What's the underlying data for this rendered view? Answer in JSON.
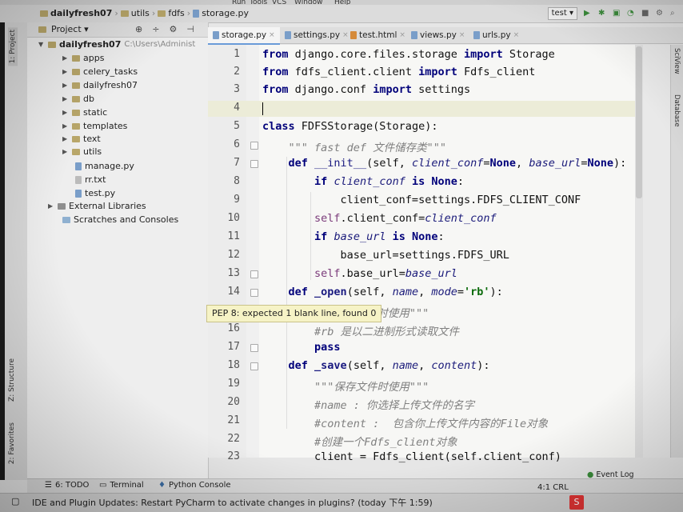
{
  "menu": {
    "items": [
      "Run",
      "Tools",
      "VCS",
      "Window",
      "Help"
    ]
  },
  "nav": {
    "crumbs": [
      "dailyfresh07",
      "utils",
      "fdfs",
      "storage.py"
    ],
    "run_config": "test"
  },
  "left_tabs": {
    "project": "1: Project",
    "structure": "Z: Structure",
    "favorites": "2: Favorites"
  },
  "project_panel": {
    "title": "Project",
    "root_name": "dailyfresh07",
    "root_path": "C:\\Users\\Administ",
    "folders": [
      "apps",
      "celery_tasks",
      "dailyfresh07",
      "db",
      "static",
      "templates",
      "text",
      "utils"
    ],
    "files": [
      "manage.py",
      "rr.txt",
      "test.py"
    ],
    "external": "External Libraries",
    "scratches": "Scratches and Consoles"
  },
  "tabs": [
    "storage.py",
    "settings.py",
    "test.html",
    "views.py",
    "urls.py"
  ],
  "editor": {
    "line_numbers": [
      "1",
      "2",
      "3",
      "4",
      "5",
      "6",
      "7",
      "8",
      "9",
      "10",
      "11",
      "12",
      "13",
      "14",
      "15",
      "16",
      "17",
      "18",
      "19",
      "20",
      "21",
      "22",
      "23"
    ],
    "tooltip": "PEP 8: expected 1 blank line, found 0"
  },
  "right_tabs": {
    "sciview": "SciView",
    "database": "Database"
  },
  "bottom": {
    "todo": "6: TODO",
    "terminal": "Terminal",
    "python_console": "Python Console",
    "event_log": "Event Log",
    "position": "4:1  CRL",
    "status_message": "IDE and Plugin Updates: Restart PyCharm to activate changes in plugins? (today 下午 1:59)"
  }
}
